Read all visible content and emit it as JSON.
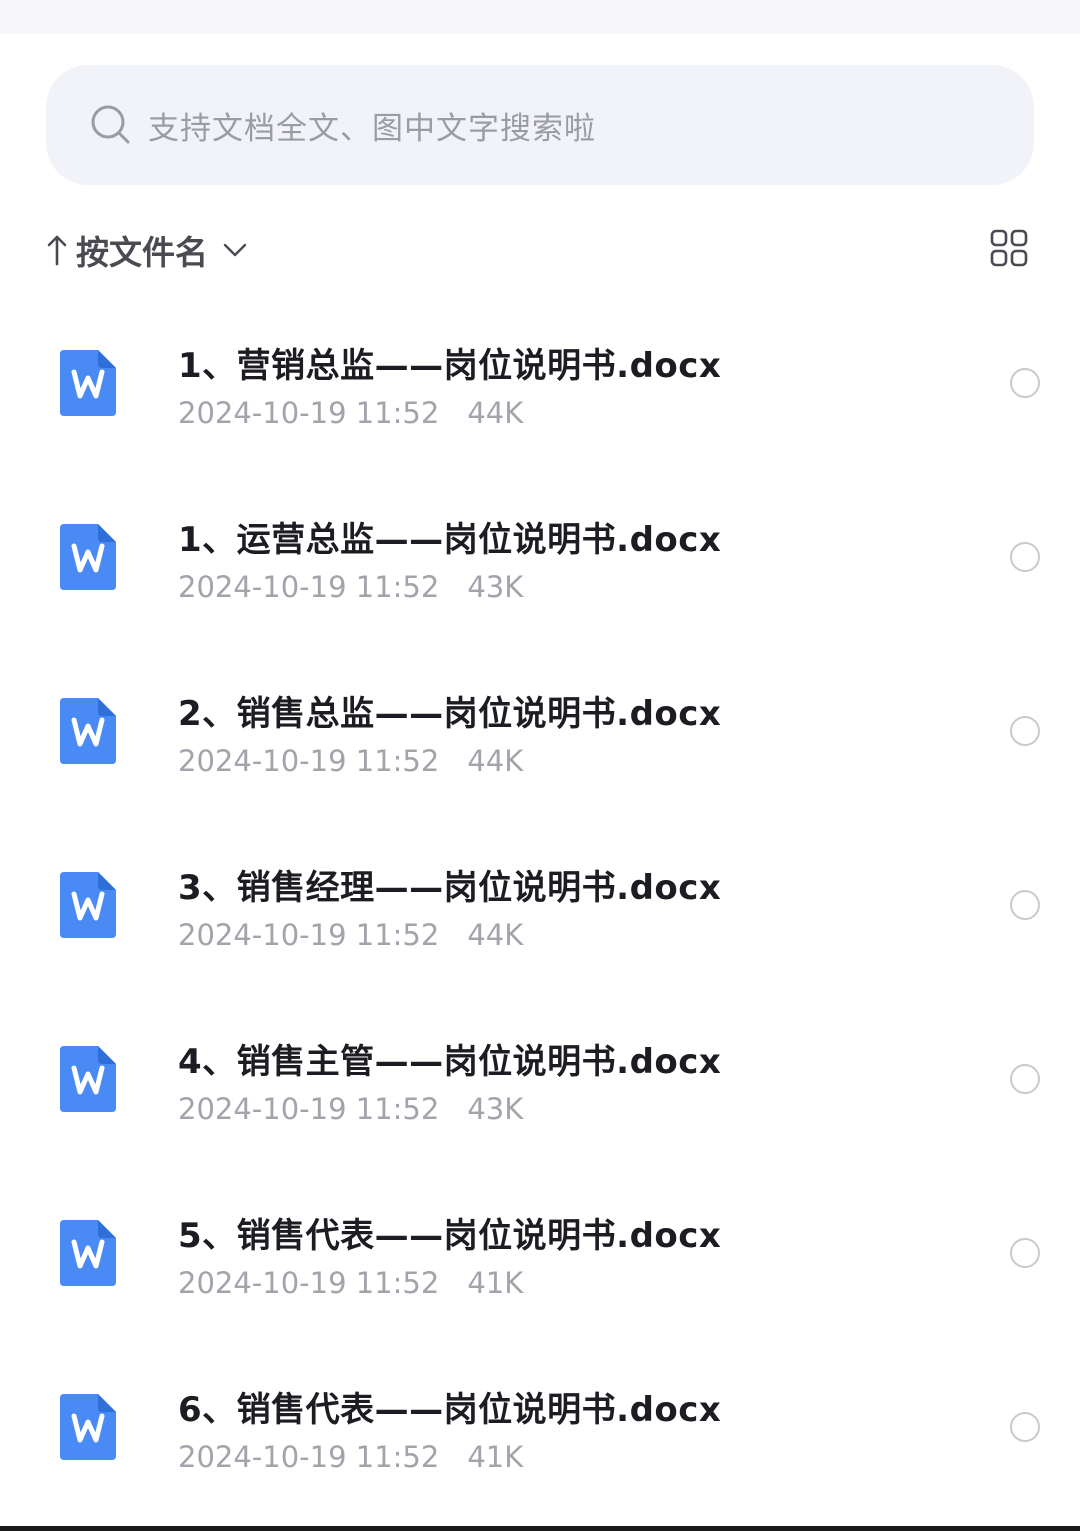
{
  "search": {
    "placeholder": "支持文档全文、图中文字搜索啦"
  },
  "sort": {
    "label": "按文件名"
  },
  "colors": {
    "doc_icon": "#4a8af4",
    "title_text": "#1c1d22",
    "meta_text": "#a3a4ab"
  },
  "files": [
    {
      "name": "1、营销总监——岗位说明书.docx",
      "date": "2024-10-19 11:52",
      "size": "44K"
    },
    {
      "name": "1、运营总监——岗位说明书.docx",
      "date": "2024-10-19 11:52",
      "size": "43K"
    },
    {
      "name": "2、销售总监——岗位说明书.docx",
      "date": "2024-10-19 11:52",
      "size": "44K"
    },
    {
      "name": "3、销售经理——岗位说明书.docx",
      "date": "2024-10-19 11:52",
      "size": "44K"
    },
    {
      "name": "4、销售主管——岗位说明书.docx",
      "date": "2024-10-19 11:52",
      "size": "43K"
    },
    {
      "name": "5、销售代表——岗位说明书.docx",
      "date": "2024-10-19 11:52",
      "size": "41K"
    },
    {
      "name": "6、销售代表——岗位说明书.docx",
      "date": "2024-10-19 11:52",
      "size": "41K"
    }
  ]
}
